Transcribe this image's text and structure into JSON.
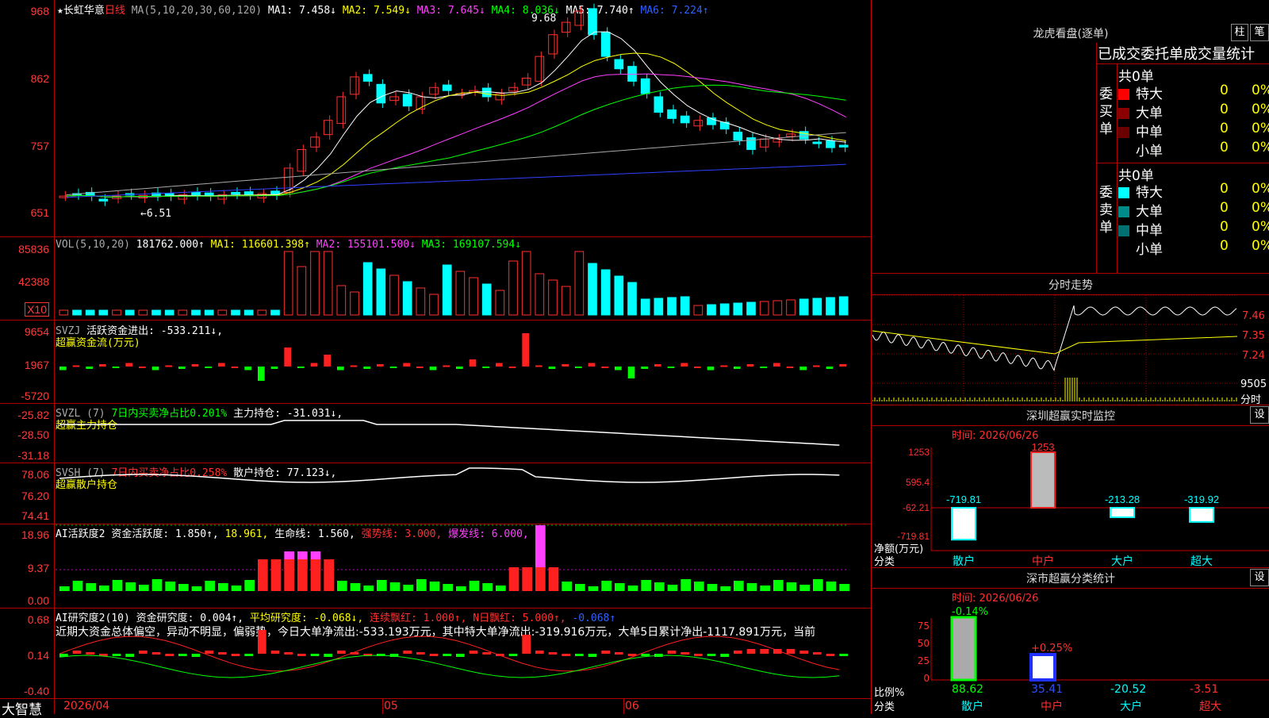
{
  "stock": {
    "star": "★",
    "name": "长虹华意",
    "period": "日线"
  },
  "main": {
    "ma_label": "MA(5,10,20,30,60,120)",
    "ma1": "MA1: 7.458↓",
    "ma2": "MA2: 7.549↓",
    "ma3": "MA3: 7.645↓",
    "ma4": "MA4: 8.036↓",
    "ma5": "MA5: 7.740↑",
    "ma6": "MA6: 7.224↑",
    "high": "9.68",
    "low": "←6.51",
    "yticks": [
      "968",
      "862",
      "757",
      "651"
    ]
  },
  "vol": {
    "label": "VOL(5,10,20)",
    "value": "181762.000↑",
    "ma1": "MA1: 116601.398↑",
    "ma2": "MA2: 155101.500↓",
    "ma3": "MA3: 169107.594↓",
    "yticks": [
      "85836",
      "42388"
    ],
    "unit": "X10"
  },
  "svzj": {
    "label": "SVZJ",
    "name": "活跃资金进出:",
    "value": "-533.211↓,",
    "sub": "超赢资金流(万元)",
    "yticks": [
      "9654",
      "1967",
      "-5720"
    ]
  },
  "svzl": {
    "label": "SVZL (7)",
    "desc": "7日内买卖净占比0.201%",
    "name": "主力持仓:",
    "value": "-31.031↓,",
    "sub": "超赢主力持仓",
    "yticks": [
      "-25.82",
      "-28.50",
      "-31.18"
    ]
  },
  "svsh": {
    "label": "SVSH (7)",
    "desc": "7日内买卖净占比0.258%",
    "name": "散户持仓:",
    "value": "77.123↓,",
    "sub": "超赢散户持仓",
    "yticks": [
      "78.06",
      "76.20",
      "74.41"
    ]
  },
  "ai2": {
    "label": "AI活跃度2",
    "v1": "资金活跃度: 1.850↑,",
    "v2": "18.961,",
    "v3": "生命线: 1.560,",
    "v4": "强势线: 3.000,",
    "v5": "爆发线: 6.000,",
    "yticks": [
      "18.96",
      "9.37",
      "0.00"
    ]
  },
  "ai3": {
    "label": "AI研究度2(10)",
    "v1": "资金研究度: 0.004↑,",
    "v2": "平均研究度: -0.068↓,",
    "v3": "连续飘红: 1.000↑,",
    "v4": "N日飘红: 5.000↑,",
    "v5": "-0.068↑",
    "comment": "近期大资金总体偏空，异动不明显，偏弱势，今日大单净流出:-533.193万元，其中特大单净流出:-319.916万元，大单5日累计净出-1117.891万元，当前",
    "yticks": [
      "0.68",
      "0.14",
      "-0.40"
    ]
  },
  "bottom": {
    "brand": "大智慧",
    "date": "2026/04",
    "m05": "05",
    "m06": "06"
  },
  "lhb": {
    "title": "龙虎看盘(逐单)",
    "btn1": "柱",
    "btn2": "笔",
    "header": "已成交委托单成交量统计",
    "buy": {
      "label": "委买单",
      "total": "共0单",
      "rows": [
        {
          "name": "特大",
          "v": "0",
          "p": "0%"
        },
        {
          "name": "大单",
          "v": "0",
          "p": "0%"
        },
        {
          "name": "中单",
          "v": "0",
          "p": "0%"
        },
        {
          "name": "小单",
          "v": "0",
          "p": "0%"
        }
      ]
    },
    "sell": {
      "label": "委卖单",
      "total": "共0单",
      "rows": [
        {
          "name": "特大",
          "v": "0",
          "p": "0%"
        },
        {
          "name": "大单",
          "v": "0",
          "p": "0%"
        },
        {
          "name": "中单",
          "v": "0",
          "p": "0%"
        },
        {
          "name": "小单",
          "v": "0",
          "p": "0%"
        }
      ]
    }
  },
  "intraday": {
    "title": "分时走势",
    "y1": "7.46",
    "y2": "7.35",
    "y3": "7.24",
    "vol": "9505",
    "unit": "分时"
  },
  "monitor": {
    "title": "深圳超赢实时监控",
    "btn": "设",
    "time": "时间: 2026/06/26",
    "yticks": [
      "1253",
      "595.4",
      "-62.21",
      "-719.81"
    ],
    "ylabel1": "净额(万元)",
    "ylabel2": "分类",
    "cats": [
      "散户",
      "中户",
      "大户",
      "超大"
    ],
    "vals": [
      "-719.81",
      "1253",
      "-213.28",
      "-319.92"
    ]
  },
  "classify": {
    "title": "深市超赢分类统计",
    "btn": "设",
    "time": "时间: 2026/06/26",
    "yticks": [
      "75",
      "50",
      "25",
      "0"
    ],
    "ylabel1": "比例%",
    "ylabel2": "分类",
    "cats": [
      "散户",
      "中户",
      "大户",
      "超大"
    ],
    "vals": [
      "88.62",
      "35.41",
      "-20.52",
      "-3.51"
    ],
    "top1": "-0.14%",
    "top2": "+0.25%"
  }
}
